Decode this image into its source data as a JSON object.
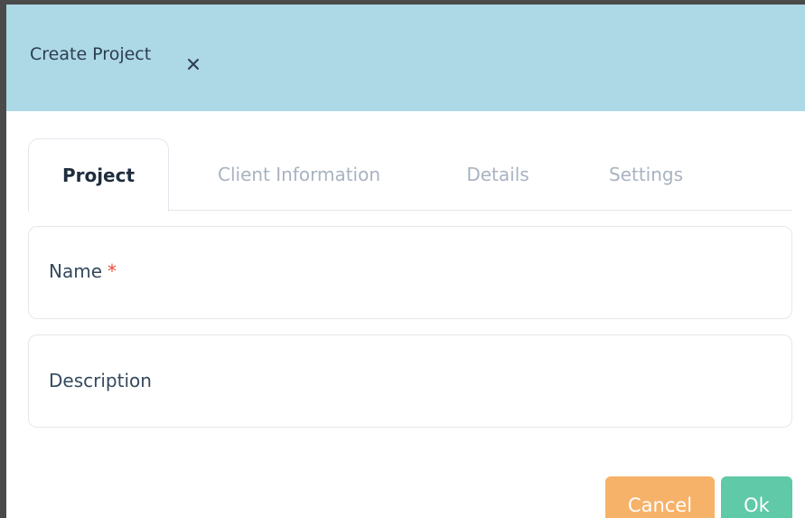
{
  "dialog": {
    "title": "Create Project",
    "close_icon": "close-icon",
    "header_color": "#add8e6"
  },
  "tabs": [
    {
      "label": "Project",
      "active": true
    },
    {
      "label": "Client Information",
      "active": false
    },
    {
      "label": "Details",
      "active": false
    },
    {
      "label": "Settings",
      "active": false
    }
  ],
  "form": {
    "name_label": "Name",
    "name_required_mark": "*",
    "description_label": "Description"
  },
  "buttons": {
    "cancel_label": "Cancel",
    "ok_label": "Ok",
    "cancel_color": "#f7b269",
    "ok_color": "#5fc9a8"
  }
}
